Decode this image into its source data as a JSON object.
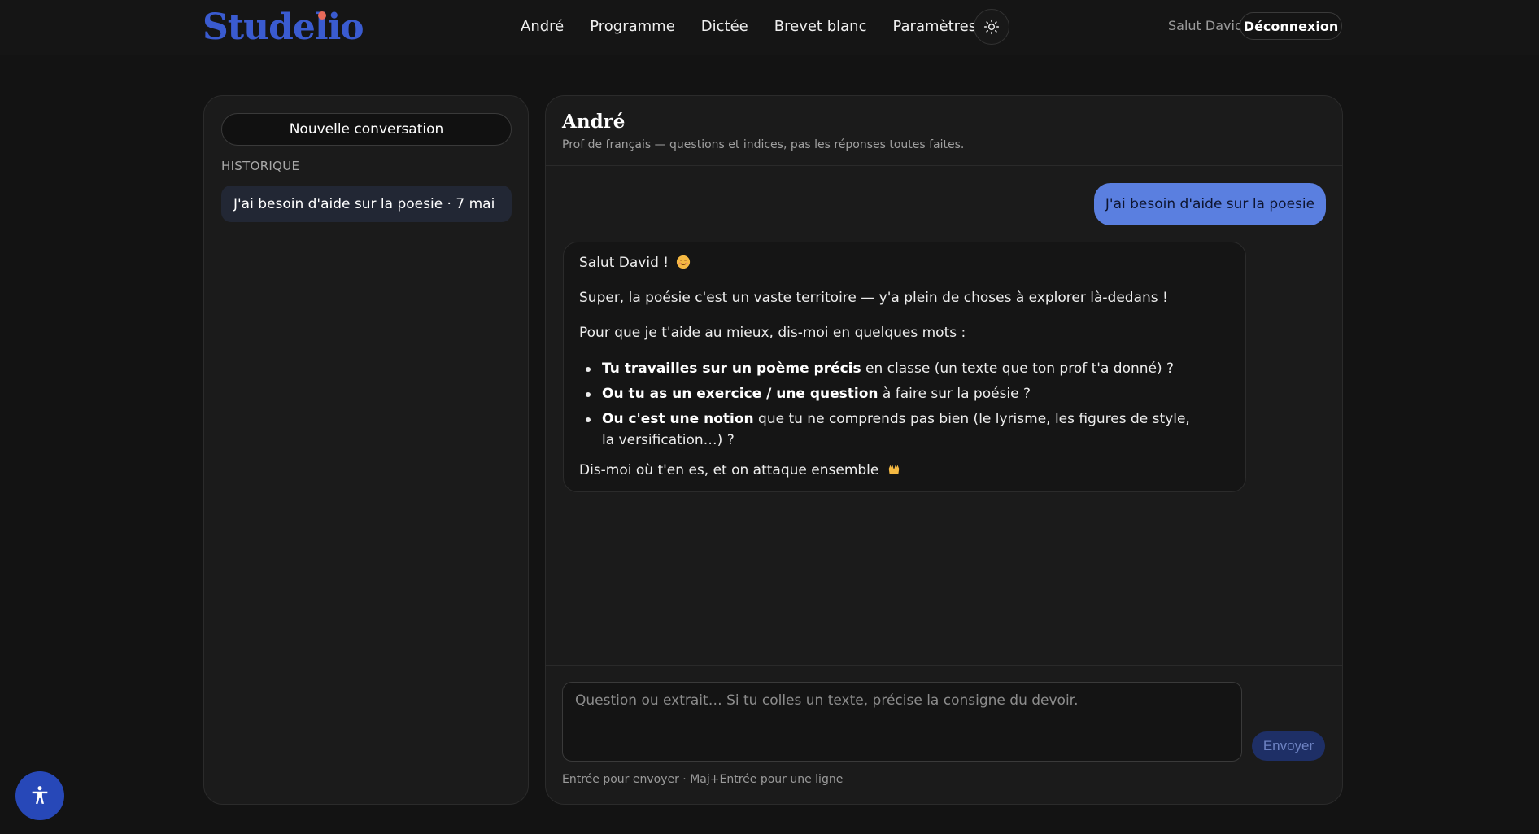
{
  "brand": {
    "name": "Studelio",
    "color": "#3a5bd0",
    "dot_color": "#e86a5a"
  },
  "nav": {
    "items": [
      {
        "label": "André"
      },
      {
        "label": "Programme"
      },
      {
        "label": "Dictée"
      },
      {
        "label": "Brevet blanc"
      },
      {
        "label": "Paramètres"
      }
    ],
    "theme_toggle_icon": "sun-icon"
  },
  "user": {
    "greeting": "Salut David",
    "logout_label": "Déconnexion"
  },
  "sidebar": {
    "new_conversation_label": "Nouvelle conversation",
    "history_label": "HISTORIQUE",
    "history_items": [
      {
        "label": "J'ai besoin d'aide sur la poesie · 7 mai"
      }
    ]
  },
  "chat": {
    "title": "André",
    "subtitle": "Prof de français — questions et indices, pas les réponses toutes faites.",
    "messages": {
      "user": {
        "text": "J'ai besoin d'aide sur la poesie"
      },
      "assistant": {
        "greeting": "Salut David !",
        "greeting_emoji": "smiling-face-emoji",
        "p1": "Super, la poésie c'est un vaste territoire — y'a plein de choses à explorer là-dedans !",
        "p2": "Pour que je t'aide au mieux, dis-moi en quelques mots :",
        "bullets": [
          {
            "bold": "Tu travailles sur un poème précis",
            "rest": " en classe (un texte que ton prof t'a donné) ?"
          },
          {
            "bold": "Ou tu as un exercice / une question",
            "rest": " à faire sur la poésie ?"
          },
          {
            "bold": "Ou c'est une notion",
            "rest": " que tu ne comprends pas bien (le lyrisme, les figures de style, la versification…) ?"
          }
        ],
        "closing": "Dis-moi où t'en es, et on attaque ensemble",
        "closing_emoji": "raising-hands-emoji"
      }
    },
    "composer": {
      "placeholder": "Question ou extrait… Si tu colles un texte, précise la consigne du devoir.",
      "value": "",
      "send_label": "Envoyer",
      "hint": "Entrée pour envoyer · Maj+Entrée pour une ligne"
    },
    "user_bubble_color": "#5a7fe0"
  },
  "accessibility_button_icon": "accessibility-icon"
}
